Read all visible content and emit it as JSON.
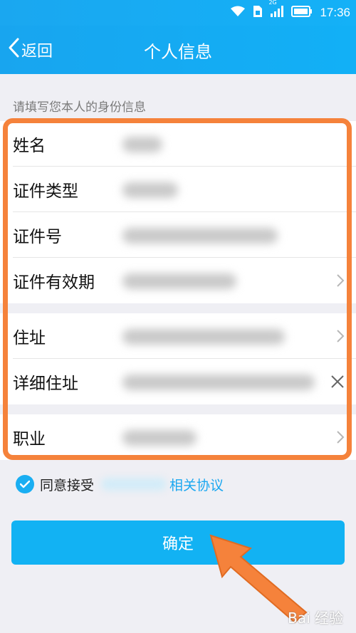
{
  "status": {
    "time": "17:36",
    "network": "2G"
  },
  "nav": {
    "back_label": "返回",
    "title": "个人信息"
  },
  "hint": "请填写您本人的身份信息",
  "fields": [
    {
      "label": "姓名"
    },
    {
      "label": "证件类型"
    },
    {
      "label": "证件号"
    },
    {
      "label": "证件有效期"
    },
    {
      "label": "住址"
    },
    {
      "label": "详细住址"
    },
    {
      "label": "职业"
    }
  ],
  "agreement": {
    "prefix": "同意接受",
    "link": "相关协议",
    "checked": true
  },
  "confirm_label": "确定",
  "watermark": "Bai 经验",
  "colors": {
    "accent": "#12b2f3",
    "highlight": "#f5823b"
  }
}
